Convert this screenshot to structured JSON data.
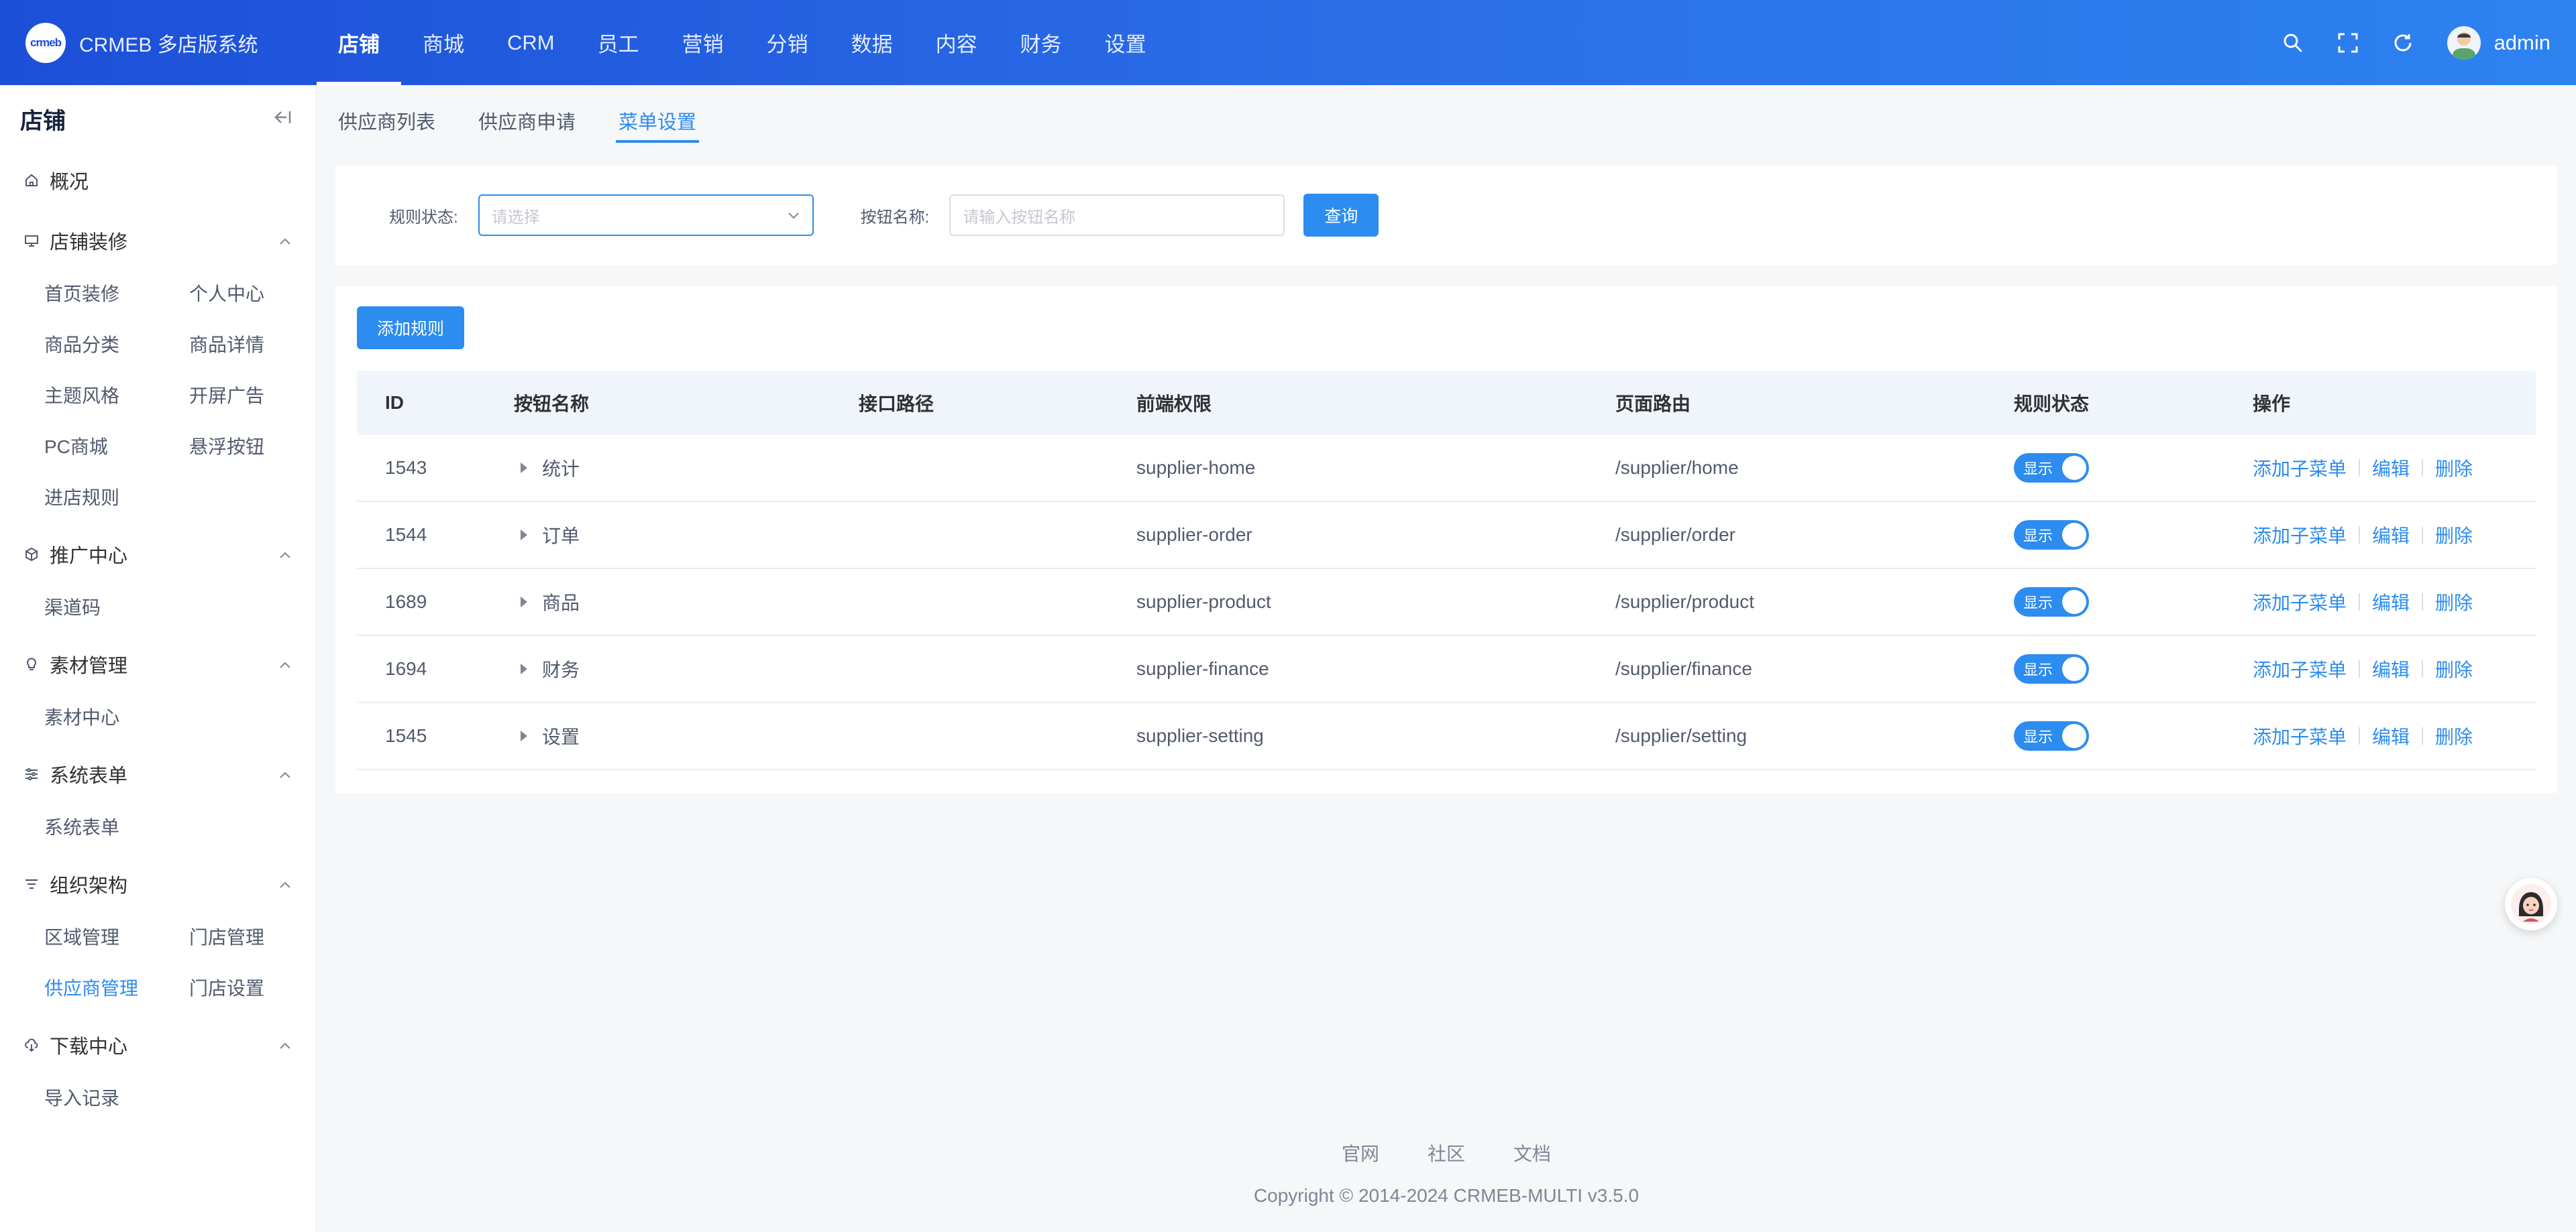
{
  "header": {
    "logo_text": "crmeb",
    "title": "CRMEB 多店版系统",
    "nav": [
      "店铺",
      "商城",
      "CRM",
      "员工",
      "营销",
      "分销",
      "数据",
      "内容",
      "财务",
      "设置"
    ],
    "user": "admin"
  },
  "sidebar": {
    "title": "店铺",
    "overview": "概况",
    "groups": [
      {
        "title": "店铺装修",
        "icon": "monitor-icon",
        "items": [
          "首页装修",
          "个人中心",
          "商品分类",
          "商品详情",
          "主题风格",
          "开屏广告",
          "PC商城",
          "悬浮按钮",
          "进店规则"
        ]
      },
      {
        "title": "推广中心",
        "icon": "cube-icon",
        "items": [
          "渠道码"
        ]
      },
      {
        "title": "素材管理",
        "icon": "bulb-icon",
        "items": [
          "素材中心"
        ]
      },
      {
        "title": "系统表单",
        "icon": "sliders-icon",
        "items": [
          "系统表单"
        ]
      },
      {
        "title": "组织架构",
        "icon": "filter-icon",
        "items": [
          "区域管理",
          "门店管理",
          "供应商管理",
          "门店设置"
        ],
        "active": "供应商管理"
      },
      {
        "title": "下载中心",
        "icon": "cloud-download-icon",
        "items": [
          "导入记录"
        ]
      }
    ]
  },
  "tabs": [
    "供应商列表",
    "供应商申请",
    "菜单设置"
  ],
  "active_tab": "菜单设置",
  "filter": {
    "status_label": "规则状态:",
    "status_placeholder": "请选择",
    "name_label": "按钮名称:",
    "name_placeholder": "请输入按钮名称",
    "query_button": "查询"
  },
  "add_rule_button": "添加规则",
  "table": {
    "headers": [
      "ID",
      "按钮名称",
      "接口路径",
      "前端权限",
      "页面路由",
      "规则状态",
      "操作"
    ],
    "rows": [
      {
        "id": "1543",
        "name": "统计",
        "path": "",
        "perm": "supplier-home",
        "route": "/supplier/home",
        "status": "显示"
      },
      {
        "id": "1544",
        "name": "订单",
        "path": "",
        "perm": "supplier-order",
        "route": "/supplier/order",
        "status": "显示"
      },
      {
        "id": "1689",
        "name": "商品",
        "path": "",
        "perm": "supplier-product",
        "route": "/supplier/product",
        "status": "显示"
      },
      {
        "id": "1694",
        "name": "财务",
        "path": "",
        "perm": "supplier-finance",
        "route": "/supplier/finance",
        "status": "显示"
      },
      {
        "id": "1545",
        "name": "设置",
        "path": "",
        "perm": "supplier-setting",
        "route": "/supplier/setting",
        "status": "显示"
      }
    ],
    "actions": [
      "添加子菜单",
      "编辑",
      "删除"
    ]
  },
  "footer": {
    "links": [
      "官网",
      "社区",
      "文档"
    ],
    "copyright": "Copyright © 2014-2024 CRMEB-MULTI v3.5.0"
  },
  "colors": {
    "primary": "#2d8cf0",
    "header_start": "#1c4fd8",
    "header_end": "#2d82f0"
  }
}
